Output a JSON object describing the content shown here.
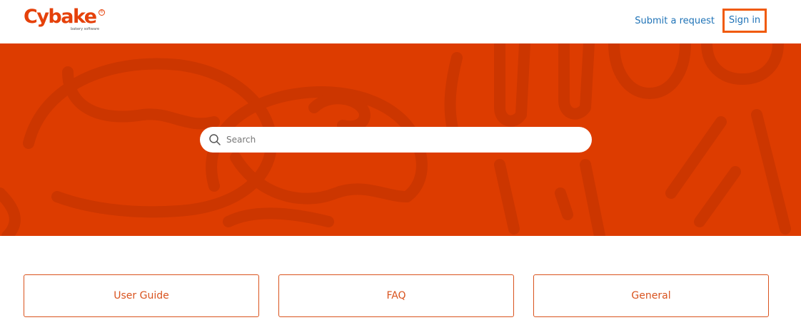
{
  "header": {
    "logo_text": "Cybake",
    "logo_mark": "®",
    "logo_tagline": "bakery software",
    "submit_request_label": "Submit a request",
    "sign_in_label": "Sign in"
  },
  "hero": {
    "background_color": "#dd3c00",
    "search": {
      "placeholder": "Search",
      "value": "",
      "icon": "search-icon"
    }
  },
  "categories": [
    {
      "label": "User Guide"
    },
    {
      "label": "FAQ"
    },
    {
      "label": "General"
    }
  ],
  "colors": {
    "brand": "#e5410a",
    "link": "#1f73b7",
    "highlight": "#f05a0a"
  }
}
